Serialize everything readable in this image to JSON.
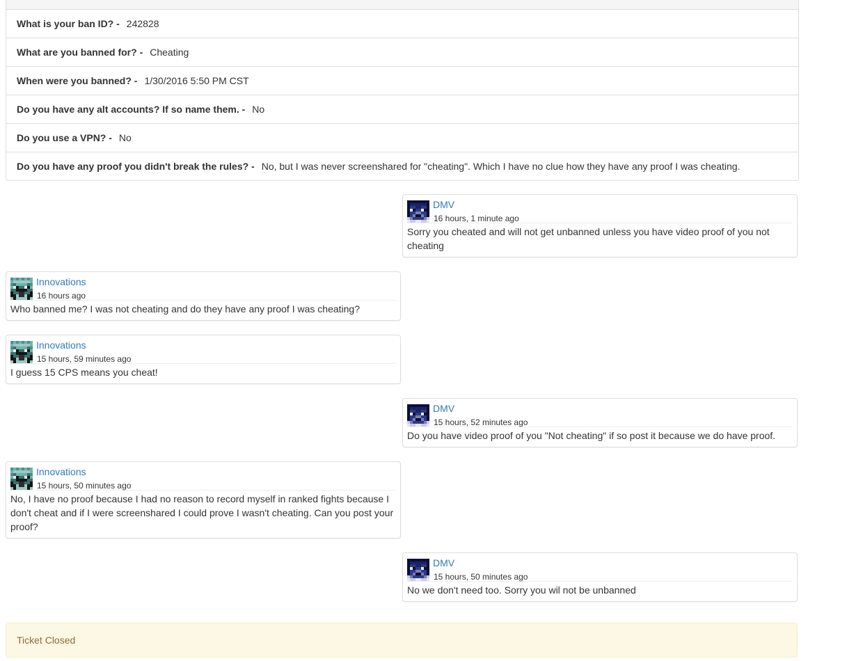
{
  "form": {
    "rows": [
      {
        "question": "What is your ban ID? -",
        "answer": "242828"
      },
      {
        "question": "What are you banned for? -",
        "answer": "Cheating"
      },
      {
        "question": "When were you banned? -",
        "answer": "1/30/2016 5:50 PM CST"
      },
      {
        "question": "Do you have any alt accounts? If so name them. -",
        "answer": "No"
      },
      {
        "question": "Do you use a VPN? -",
        "answer": "No"
      },
      {
        "question": "Do you have any proof you didn't break the rules? -",
        "answer": "No, but I was never screenshared for \"cheating\". Which I have no clue how they have any proof I was cheating."
      }
    ]
  },
  "messages": [
    {
      "author": "DMV",
      "time": "16 hours, 1 minute ago",
      "text": "Sorry you cheated and will not get unbanned unless you have video proof of you not cheating"
    },
    {
      "author": "Innovations",
      "time": "16 hours ago",
      "text": "Who banned me? I was not cheating and do they have any proof I was cheating?"
    },
    {
      "author": "Innovations",
      "time": "15 hours, 59 minutes ago",
      "text": "I guess 15 CPS means you cheat!"
    },
    {
      "author": "DMV",
      "time": "15 hours, 52 minutes ago",
      "text": "Do you have video proof of you \"Not cheating\" if so post it because we do have proof."
    },
    {
      "author": "Innovations",
      "time": "15 hours, 50 minutes ago",
      "text": "No, I have no proof because I had no reason to record myself in ranked fights because I don't cheat and if I were screenshared I could prove I wasn't cheating. Can you post your proof?"
    },
    {
      "author": "DMV",
      "time": "15 hours, 50 minutes ago",
      "text": "No we don't need too. Sorry you wil not be unbanned"
    }
  ],
  "status": {
    "label": "Ticket Closed"
  },
  "colors": {
    "link": "#337ab7",
    "closed_bg": "#fcf8e3",
    "closed_text": "#8a6d3b"
  }
}
